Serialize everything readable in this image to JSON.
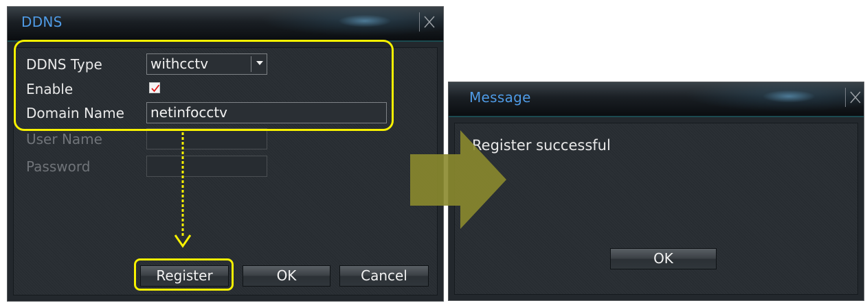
{
  "ddns_dialog": {
    "title": "DDNS",
    "fields": {
      "ddns_type": {
        "label": "DDNS Type",
        "value": "withcctv"
      },
      "enable": {
        "label": "Enable",
        "checked": true
      },
      "domain_name": {
        "label": "Domain Name",
        "value": "netinfocctv"
      },
      "user_name": {
        "label": "User Name",
        "value": ""
      },
      "password": {
        "label": "Password",
        "value": ""
      }
    },
    "buttons": {
      "register": "Register",
      "ok": "OK",
      "cancel": "Cancel"
    }
  },
  "message_dialog": {
    "title": "Message",
    "text": "Register successful",
    "ok": "OK"
  },
  "colors": {
    "title_text": "#4f9be6",
    "highlight": "#f8f200",
    "arrow": "#8b8a2e"
  }
}
